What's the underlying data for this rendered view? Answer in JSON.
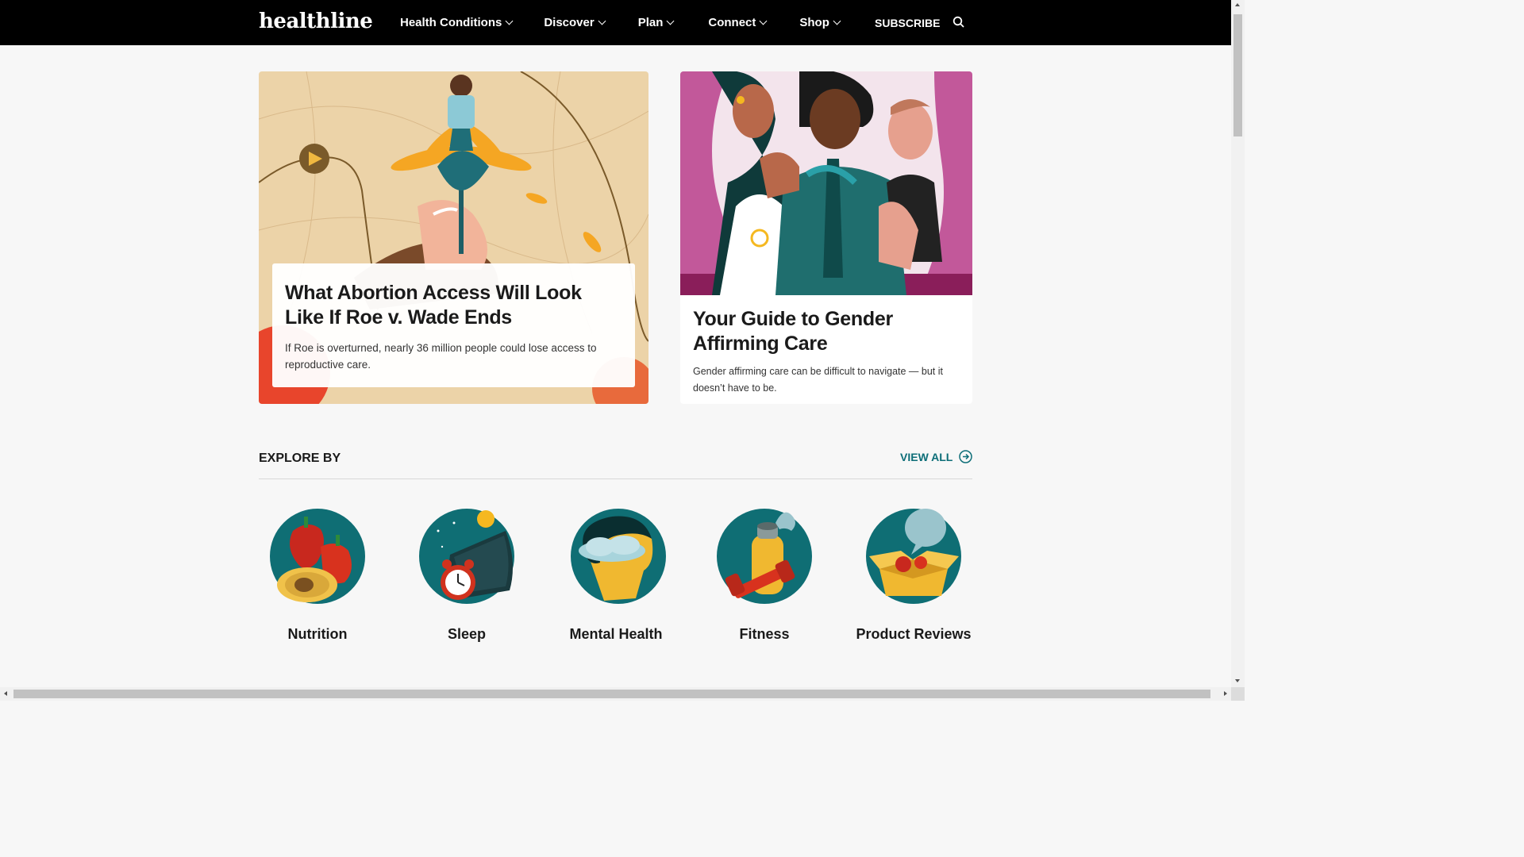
{
  "header": {
    "logo": "healthline",
    "nav": [
      {
        "label": "Health Conditions"
      },
      {
        "label": "Discover"
      },
      {
        "label": "Plan"
      },
      {
        "label": "Connect"
      },
      {
        "label": "Shop"
      }
    ],
    "subscribe": "SUBSCRIBE"
  },
  "hero": {
    "left": {
      "title": "What Abortion Access Will Look Like If Roe v. Wade Ends",
      "description": "If Roe is overturned, nearly 36 million people could lose access to reproductive care."
    },
    "right": {
      "title": "Your Guide to Gender Affirming Care",
      "description": "Gender affirming care can be difficult to navigate — but it doesn’t have to be."
    }
  },
  "explore": {
    "title": "EXPLORE BY",
    "view_all": "VIEW ALL",
    "topics": [
      {
        "label": "Nutrition",
        "icon": "nutrition-icon"
      },
      {
        "label": "Sleep",
        "icon": "sleep-icon"
      },
      {
        "label": "Mental Health",
        "icon": "mental-health-icon"
      },
      {
        "label": "Fitness",
        "icon": "fitness-icon"
      },
      {
        "label": "Product Reviews",
        "icon": "product-reviews-icon"
      }
    ]
  },
  "colors": {
    "header_bg": "#000000",
    "accent_teal": "#0d6e78",
    "page_bg": "#f7f7f7"
  }
}
